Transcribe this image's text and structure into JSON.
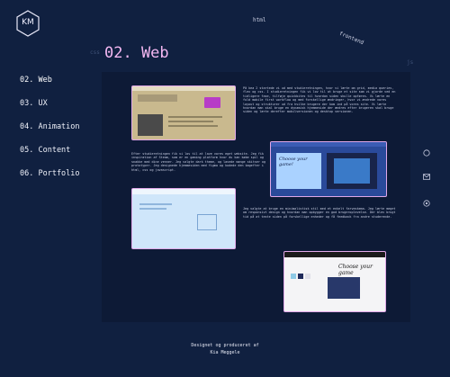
{
  "logo": {
    "text": "KM"
  },
  "floating_labels": {
    "html": "html",
    "frontend": "frontend",
    "ghost_left": "css",
    "ghost_right": "js"
  },
  "nav": {
    "items": [
      {
        "label": "02. Web"
      },
      {
        "label": "03. UX"
      },
      {
        "label": "04. Animation"
      },
      {
        "label": "05. Content"
      },
      {
        "label": "06. Portfolio"
      }
    ]
  },
  "section": {
    "title": "02. Web"
  },
  "paragraphs": {
    "p1": "På kea 2 startede vi ud med studieretningen, hvor vi lærte om grid, media queries, flex og css. I studieretningen fik vi lov til at bruge et site som vi gjorde ved en tidligere fase, tilføje quickbites til hvordan siden skulle opføres. Vi lærte en fuld mobile first workflow og med forskellige ændringer, hvor vi ændrede vores layout og strukturer ud fra hvilke brugere der kom ind på vores site. Vi lærte hvordan man skal bruge en dynamisk hjemmeside der ændres efter brugeren skal bruge siden og lærte derefter mobilversionen og desktop versionen.",
    "p2": "Efter studieretningen fik vi lov til at lave vores eget website. Jeg fik inspiration af Steam, som er en gaming platform hvor du kan købe spil og snakke med dine venner. Jeg valgte dark theme, og lavede mange skitser og prototyper. Jeg designede hjemmesiden med figma og kodede den bagefter i html, css og javascript.",
    "p3": "Jeg valgte at bruge en minimalistisk stil med et enkelt farveskema. Jeg lærte meget om responsivt design og hvordan man opbygger en god brugeroplevelse. Der blev brugt tid på at teste siden på forskellige enheder og få feedback fra andre studerende."
  },
  "mockup3": {
    "heading": "Choose your game!"
  },
  "mockup4": {
    "heading": "Choose your game"
  },
  "social": {
    "github": "github-icon",
    "mail": "mail-icon",
    "linkedin": "linkedin-icon"
  },
  "footer": {
    "line1": "Designet og produceret af",
    "line2": "Kia Meggele"
  },
  "colors": {
    "accent": "#f4b8f2",
    "background": "#102040",
    "panel": "#0d1a36"
  }
}
